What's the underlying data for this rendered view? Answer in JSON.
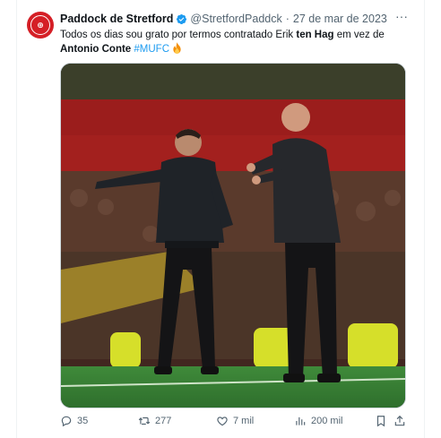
{
  "tweet": {
    "author_name": "Paddock de Stretford",
    "author_handle": "@StretfordPaddck",
    "separator": "·",
    "date": "27 de mar de 2023",
    "more_label": "···",
    "text_part1": "Todos os dias sou grato por termos contratado Erik ",
    "text_bold1": "ten Hag",
    "text_part2": " em vez de ",
    "text_bold2": "Antonio Conte",
    "text_space": " ",
    "hashtag": "#MUFC",
    "emoji_name": "fire-icon"
  },
  "actions": {
    "replies": "35",
    "retweets": "277",
    "likes": "7 mil",
    "views": "200 mil"
  },
  "colors": {
    "brand_red": "#d51f26",
    "verified_blue": "#1d9bf0",
    "muted": "#536471"
  }
}
